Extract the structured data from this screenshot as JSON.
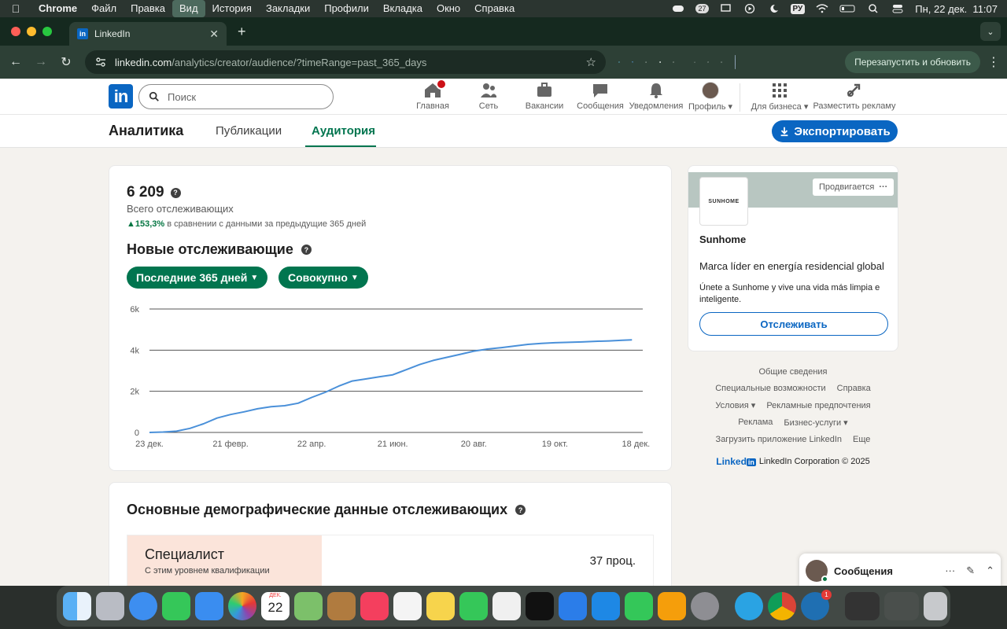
{
  "menubar": {
    "app": "Chrome",
    "items": [
      "Файл",
      "Правка",
      "Вид",
      "История",
      "Закладки",
      "Профили",
      "Вкладка",
      "Окно",
      "Справка"
    ],
    "active_index": 2,
    "notif_count": "27",
    "lang": "РУ",
    "datetime": "Пн, 22 дек.  11:07"
  },
  "browser": {
    "tab_title": "LinkedIn",
    "url_host": "linkedin.com",
    "url_path": "/analytics/creator/audience/?timeRange=past_365_days",
    "relaunch_label": "Перезапустить и обновить"
  },
  "linkedin": {
    "search_placeholder": "Поиск",
    "nav": [
      {
        "label": "Главная",
        "icon": "home-icon"
      },
      {
        "label": "Сеть",
        "icon": "network-icon"
      },
      {
        "label": "Вакансии",
        "icon": "briefcase-icon"
      },
      {
        "label": "Сообщения",
        "icon": "chat-icon"
      },
      {
        "label": "Уведомления",
        "icon": "bell-icon"
      },
      {
        "label": "Профиль ▾",
        "icon": "avatar"
      },
      {
        "label": "Для бизнеса ▾",
        "icon": "grid-icon"
      },
      {
        "label": "Разместить рекламу",
        "icon": "ad-icon"
      }
    ],
    "subnav": {
      "title": "Аналитика",
      "tabs": [
        "Публикации",
        "Аудитория"
      ],
      "active_tab": 1,
      "export_label": "Экспортировать"
    }
  },
  "stats": {
    "total": "6 209",
    "total_label": "Всего отслеживающих",
    "delta": "153,3%",
    "delta_text": "в сравнении с данными за предыдущие 365 дней",
    "section_title": "Новые отслеживающие",
    "filter_range": "Последние 365 дней",
    "filter_mode": "Совокупно"
  },
  "chart_data": {
    "type": "line",
    "title": "",
    "xlabel": "",
    "ylabel": "",
    "ylim": [
      0,
      6000
    ],
    "y_ticks": [
      "0",
      "2k",
      "4k",
      "6k"
    ],
    "y_tick_values": [
      0,
      2000,
      4000,
      6000
    ],
    "x_tick_labels": [
      "23 дек.",
      "21 февр.",
      "22 апр.",
      "21 июн.",
      "20 авг.",
      "19 окт.",
      "18 дек."
    ],
    "x_tick_days": [
      0,
      60,
      120,
      180,
      240,
      300,
      360
    ],
    "grid": true,
    "series": [
      {
        "color": "#4a90d9",
        "x_days": [
          0,
          10,
          20,
          30,
          40,
          50,
          60,
          70,
          80,
          90,
          100,
          110,
          120,
          130,
          140,
          150,
          160,
          170,
          180,
          190,
          200,
          210,
          220,
          230,
          240,
          250,
          260,
          270,
          280,
          290,
          300,
          310,
          320,
          330,
          340,
          350,
          357
        ],
        "values": [
          0,
          20,
          60,
          200,
          420,
          700,
          870,
          1000,
          1150,
          1250,
          1300,
          1420,
          1700,
          1950,
          2250,
          2500,
          2600,
          2700,
          2800,
          3050,
          3300,
          3500,
          3650,
          3800,
          3950,
          4050,
          4120,
          4200,
          4280,
          4330,
          4360,
          4380,
          4400,
          4430,
          4450,
          4480,
          4500
        ]
      }
    ]
  },
  "ad": {
    "promoted_label": "Продвигается",
    "logo_text": "SUNHOME",
    "company": "Sunhome",
    "headline": "Marca líder en energía residencial global",
    "body": "Únete a Sunhome y vive una vida más limpia e inteligente.",
    "follow_label": "Отслеживать"
  },
  "footer": {
    "rows": [
      [
        "Общие сведения"
      ],
      [
        "Специальные возможности",
        "Справка"
      ],
      [
        "Условия ▾",
        "Рекламные предпочтения"
      ],
      [
        "Реклама",
        "Бизнес-услуги ▾"
      ],
      [
        "Загрузить приложение LinkedIn",
        "Еще"
      ]
    ],
    "brand": "Linked",
    "brand_in": "in",
    "copyright": "LinkedIn Corporation © 2025"
  },
  "demographics": {
    "title": "Основные демографические данные отслеживающих",
    "item_title": "Специалист",
    "item_sub": "С этим уровнем квалификации",
    "item_pct": "37 проц.",
    "item_fraction": 0.37
  },
  "messaging": {
    "title": "Сообщения"
  },
  "dock": {
    "calendar_month": "ДЕК.",
    "calendar_day": "22",
    "badge": "1"
  }
}
